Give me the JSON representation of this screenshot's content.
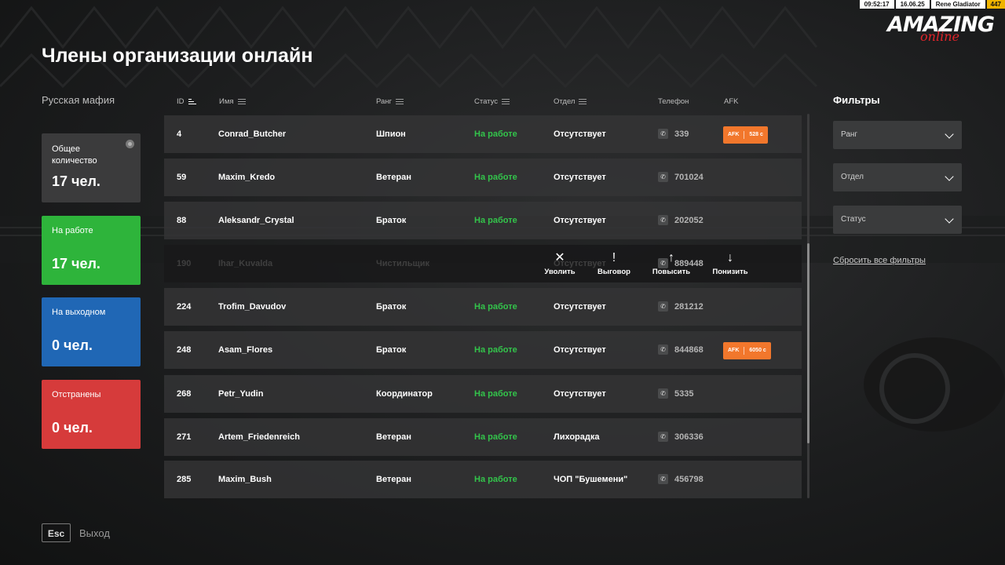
{
  "hud": {
    "time": "09:52:17",
    "date": "16.06.25",
    "player": "Rene Gladiator",
    "level": "447"
  },
  "logo": {
    "main": "AMAZING",
    "sub": "online"
  },
  "page": {
    "title": "Члены организации онлайн",
    "org_name": "Русская мафия"
  },
  "stats": {
    "total": {
      "label": "Общее количество",
      "value": "17 чел."
    },
    "at_work": {
      "label": "На работе",
      "value": "17 чел."
    },
    "day_off": {
      "label": "На выходном",
      "value": "0 чел."
    },
    "suspended": {
      "label": "Отстранены",
      "value": "0 чел."
    }
  },
  "colors": {
    "at_work": "#2eb43b",
    "day_off": "#2067b5",
    "suspended": "#d63b3b",
    "afk": "#f2772c",
    "status_text": "#33c44b"
  },
  "table": {
    "headers": {
      "id": "ID",
      "name": "Имя",
      "rank": "Ранг",
      "status": "Статус",
      "dept": "Отдел",
      "phone": "Телефон",
      "afk": "AFK"
    },
    "rows": [
      {
        "id": "4",
        "name": "Conrad_Butcher",
        "rank": "Шпион",
        "status": "На работе",
        "dept": "Отсутствует",
        "phone": "339",
        "afk_label": "AFK",
        "afk_time": "528 с"
      },
      {
        "id": "59",
        "name": "Maxim_Kredo",
        "rank": "Ветеран",
        "status": "На работе",
        "dept": "Отсутствует",
        "phone": "701024"
      },
      {
        "id": "88",
        "name": "Aleksandr_Crystal",
        "rank": "Браток",
        "status": "На работе",
        "dept": "Отсутствует",
        "phone": "202052"
      },
      {
        "id": "190",
        "name": "Ihar_Kuvalda",
        "rank": "Чистильщик",
        "status": "На работе",
        "dept": "Отсутствует",
        "phone": "889448"
      },
      {
        "id": "224",
        "name": "Trofim_Davudov",
        "rank": "Браток",
        "status": "На работе",
        "dept": "Отсутствует",
        "phone": "281212"
      },
      {
        "id": "248",
        "name": "Asam_Flores",
        "rank": "Браток",
        "status": "На работе",
        "dept": "Отсутствует",
        "phone": "844868",
        "afk_label": "AFK",
        "afk_time": "6050 с"
      },
      {
        "id": "268",
        "name": "Petr_Yudin",
        "rank": "Координатор",
        "status": "На работе",
        "dept": "Отсутствует",
        "phone": "5335"
      },
      {
        "id": "271",
        "name": "Artem_Friedenreich",
        "rank": "Ветеран",
        "status": "На работе",
        "dept": "Лихорадка",
        "phone": "306336"
      },
      {
        "id": "285",
        "name": "Maxim_Bush",
        "rank": "Ветеран",
        "status": "На работе",
        "dept": "ЧОП \"Бушемени\"",
        "phone": "456798"
      }
    ]
  },
  "row_actions": {
    "fire": {
      "icon": "close-icon",
      "label": "Уволить"
    },
    "reprimand": {
      "icon": "exclamation-icon",
      "label": "Выговор"
    },
    "promote": {
      "icon": "arrow-up-icon",
      "label": "Повысить"
    },
    "demote": {
      "icon": "arrow-down-icon",
      "label": "Понизить"
    }
  },
  "filters": {
    "title": "Фильтры",
    "rank": "Ранг",
    "dept": "Отдел",
    "status": "Статус",
    "reset": "Сбросить все фильтры"
  },
  "footer": {
    "esc_key": "Esc",
    "exit_label": "Выход"
  }
}
